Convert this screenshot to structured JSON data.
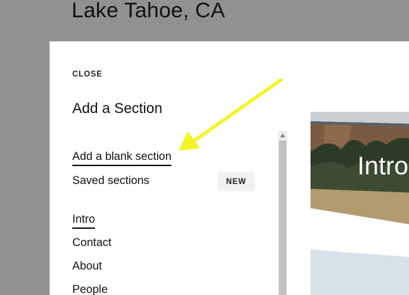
{
  "background": {
    "page_title": "Lake Tahoe, CA"
  },
  "panel": {
    "close_label": "CLOSE",
    "heading": "Add a Section",
    "add_blank_label": "Add a blank section",
    "saved_label": "Saved sections",
    "new_badge": "NEW",
    "sections": [
      "Intro",
      "Contact",
      "About",
      "People"
    ]
  },
  "previews": {
    "first_title": "Intro"
  },
  "colors": {
    "overlay": "#919191",
    "annotation_arrow": "#f4f42a",
    "accent_text": "#111111"
  },
  "icons": {
    "scroll_up": "triangle-up-icon",
    "annotation": "arrow-annotation-icon"
  }
}
